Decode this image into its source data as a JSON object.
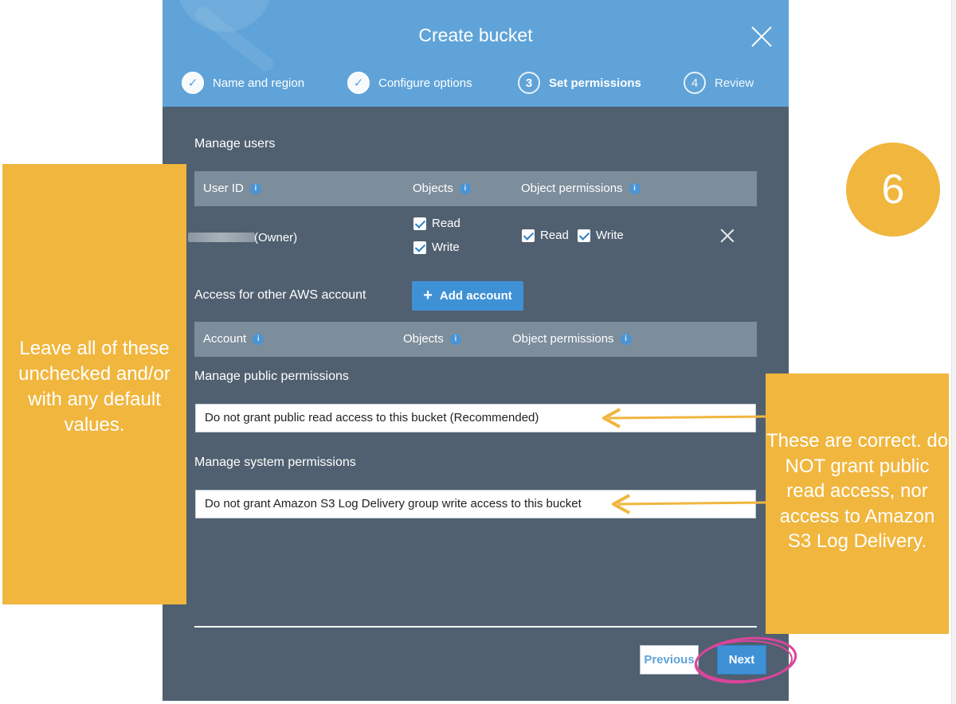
{
  "modal": {
    "title": "Create bucket",
    "steps": [
      {
        "num": "1",
        "label": "Name and region",
        "state": "done"
      },
      {
        "num": "2",
        "label": "Configure options",
        "state": "done"
      },
      {
        "num": "3",
        "label": "Set permissions",
        "state": "active"
      },
      {
        "num": "4",
        "label": "Review",
        "state": "future"
      }
    ],
    "manage_users": {
      "label": "Manage users",
      "columns": [
        "User ID",
        "Objects",
        "Object permissions"
      ],
      "owner_row": {
        "user_label": "(Owner)",
        "objects": [
          {
            "label": "Read",
            "checked": true
          },
          {
            "label": "Write",
            "checked": true
          }
        ],
        "object_permissions": [
          {
            "label": "Read",
            "checked": true
          },
          {
            "label": "Write",
            "checked": true
          }
        ]
      }
    },
    "other_accounts": {
      "label": "Access for other AWS account",
      "add_button": "Add account",
      "columns": [
        "Account",
        "Objects",
        "Object permissions"
      ]
    },
    "public_permissions": {
      "label": "Manage public permissions",
      "selected": "Do not grant public read access to this bucket (Recommended)"
    },
    "system_permissions": {
      "label": "Manage system permissions",
      "selected": "Do not grant Amazon S3 Log Delivery group write access to this bucket"
    },
    "buttons": {
      "previous": "Previous",
      "next": "Next"
    }
  },
  "annotations": {
    "left_note": "Leave all of these unchecked and/or with any default values.",
    "right_note": "These are correct. do NOT grant public read access, nor access to Amazon S3 Log Delivery.",
    "step_badge": "6"
  },
  "colors": {
    "header_blue": "#5fa3d8",
    "modal_slate": "#506070",
    "table_header": "#7c8d9b",
    "button_blue": "#3f91d6",
    "annotation_yellow": "#f0b63e",
    "ring_pink": "#d9459a"
  }
}
